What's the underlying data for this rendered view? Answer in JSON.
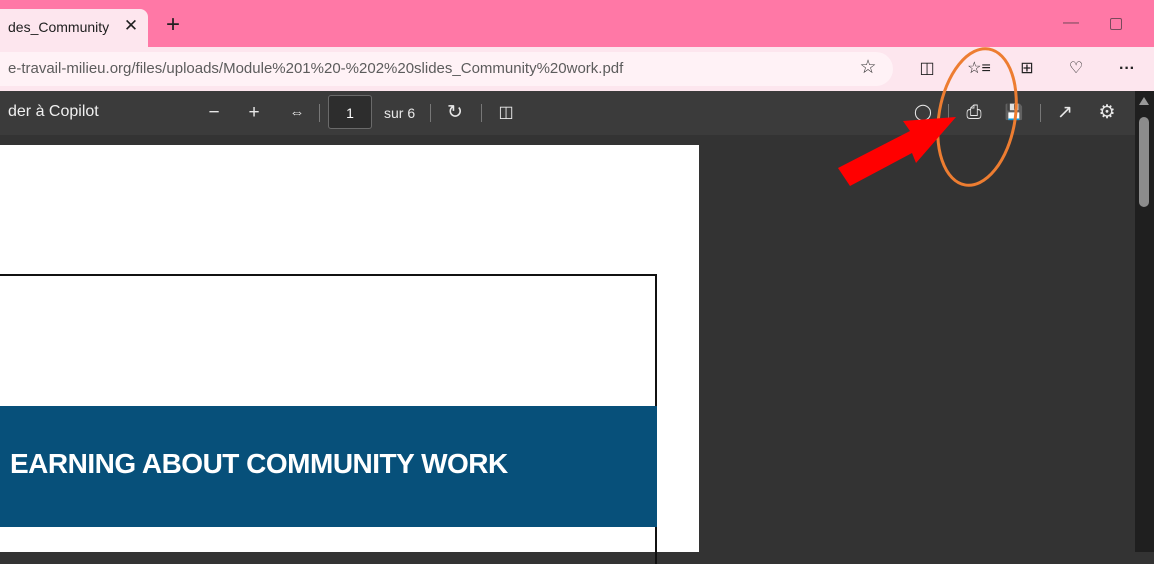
{
  "tab": {
    "title": "des_Community",
    "close": "✕",
    "new_tab": "+"
  },
  "window": {
    "minimize": "—"
  },
  "address": {
    "url": "e-travail-milieu.org/files/uploads/Module%201%20-%202%20slides_Community%20work.pdf",
    "favorite_icon": "☆"
  },
  "toolbar_icons": {
    "split_screen": "◫",
    "favorites": "☆≡",
    "collections": "⊞",
    "health": "♡",
    "more": "···"
  },
  "pdf_toolbar": {
    "copilot_label": "der à Copilot",
    "zoom_out": "−",
    "zoom_in": "+",
    "fit_width": "⇔",
    "page_current": "1",
    "page_total": "sur 6",
    "rotate": "↻",
    "page_view": "◫",
    "search": "◯",
    "print": "⎙",
    "save": "💾",
    "expand": "↗",
    "settings": "⚙"
  },
  "slide": {
    "title": "EARNING ABOUT COMMUNITY WORK"
  },
  "annotations": {
    "arrow_color": "#ff0000",
    "circle_color": "#ed7d31"
  }
}
